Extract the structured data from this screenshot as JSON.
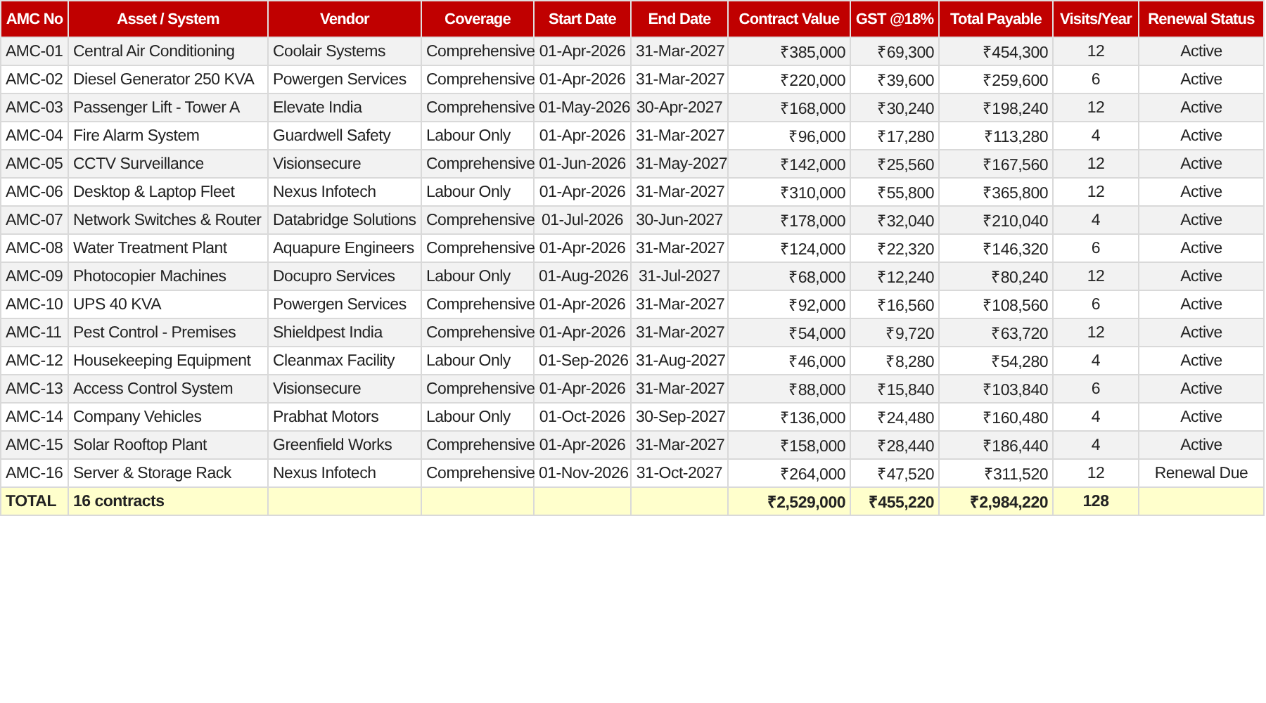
{
  "table": {
    "columns": [
      "AMC No",
      "Asset / System",
      "Vendor",
      "Coverage",
      "Start Date",
      "End Date",
      "Contract Value",
      "GST @18%",
      "Total Payable",
      "Visits/Year",
      "Renewal Status"
    ],
    "rows": [
      [
        "AMC-01",
        "Central Air Conditioning",
        "Coolair Systems",
        "Comprehensive",
        "01-Apr-2026",
        "31-Mar-2027",
        "₹385,000",
        "₹69,300",
        "₹454,300",
        "12",
        "Active"
      ],
      [
        "AMC-02",
        "Diesel Generator 250 KVA",
        "Powergen Services",
        "Comprehensive",
        "01-Apr-2026",
        "31-Mar-2027",
        "₹220,000",
        "₹39,600",
        "₹259,600",
        "6",
        "Active"
      ],
      [
        "AMC-03",
        "Passenger Lift - Tower A",
        "Elevate India",
        "Comprehensive",
        "01-May-2026",
        "30-Apr-2027",
        "₹168,000",
        "₹30,240",
        "₹198,240",
        "12",
        "Active"
      ],
      [
        "AMC-04",
        "Fire Alarm System",
        "Guardwell Safety",
        "Labour Only",
        "01-Apr-2026",
        "31-Mar-2027",
        "₹96,000",
        "₹17,280",
        "₹113,280",
        "4",
        "Active"
      ],
      [
        "AMC-05",
        "CCTV Surveillance",
        "Visionsecure",
        "Comprehensive",
        "01-Jun-2026",
        "31-May-2027",
        "₹142,000",
        "₹25,560",
        "₹167,560",
        "12",
        "Active"
      ],
      [
        "AMC-06",
        "Desktop & Laptop Fleet",
        "Nexus Infotech",
        "Labour Only",
        "01-Apr-2026",
        "31-Mar-2027",
        "₹310,000",
        "₹55,800",
        "₹365,800",
        "12",
        "Active"
      ],
      [
        "AMC-07",
        "Network Switches & Router",
        "Databridge Solutions",
        "Comprehensive",
        "01-Jul-2026",
        "30-Jun-2027",
        "₹178,000",
        "₹32,040",
        "₹210,040",
        "4",
        "Active"
      ],
      [
        "AMC-08",
        "Water Treatment Plant",
        "Aquapure Engineers",
        "Comprehensive",
        "01-Apr-2026",
        "31-Mar-2027",
        "₹124,000",
        "₹22,320",
        "₹146,320",
        "6",
        "Active"
      ],
      [
        "AMC-09",
        "Photocopier Machines",
        "Docupro Services",
        "Labour Only",
        "01-Aug-2026",
        "31-Jul-2027",
        "₹68,000",
        "₹12,240",
        "₹80,240",
        "12",
        "Active"
      ],
      [
        "AMC-10",
        "UPS 40 KVA",
        "Powergen Services",
        "Comprehensive",
        "01-Apr-2026",
        "31-Mar-2027",
        "₹92,000",
        "₹16,560",
        "₹108,560",
        "6",
        "Active"
      ],
      [
        "AMC-11",
        "Pest Control - Premises",
        "Shieldpest India",
        "Comprehensive",
        "01-Apr-2026",
        "31-Mar-2027",
        "₹54,000",
        "₹9,720",
        "₹63,720",
        "12",
        "Active"
      ],
      [
        "AMC-12",
        "Housekeeping Equipment",
        "Cleanmax Facility",
        "Labour Only",
        "01-Sep-2026",
        "31-Aug-2027",
        "₹46,000",
        "₹8,280",
        "₹54,280",
        "4",
        "Active"
      ],
      [
        "AMC-13",
        "Access Control System",
        "Visionsecure",
        "Comprehensive",
        "01-Apr-2026",
        "31-Mar-2027",
        "₹88,000",
        "₹15,840",
        "₹103,840",
        "6",
        "Active"
      ],
      [
        "AMC-14",
        "Company Vehicles",
        "Prabhat Motors",
        "Labour Only",
        "01-Oct-2026",
        "30-Sep-2027",
        "₹136,000",
        "₹24,480",
        "₹160,480",
        "4",
        "Active"
      ],
      [
        "AMC-15",
        "Solar Rooftop Plant",
        "Greenfield Works",
        "Comprehensive",
        "01-Apr-2026",
        "31-Mar-2027",
        "₹158,000",
        "₹28,440",
        "₹186,440",
        "4",
        "Active"
      ],
      [
        "AMC-16",
        "Server & Storage Rack",
        "Nexus Infotech",
        "Comprehensive",
        "01-Nov-2026",
        "31-Oct-2027",
        "₹264,000",
        "₹47,520",
        "₹311,520",
        "12",
        "Renewal Due"
      ]
    ],
    "total": {
      "label": "TOTAL",
      "description": "16 contracts",
      "contract_value": "₹2,529,000",
      "gst": "₹455,220",
      "total_payable": "₹2,984,220",
      "visits": "128"
    }
  }
}
